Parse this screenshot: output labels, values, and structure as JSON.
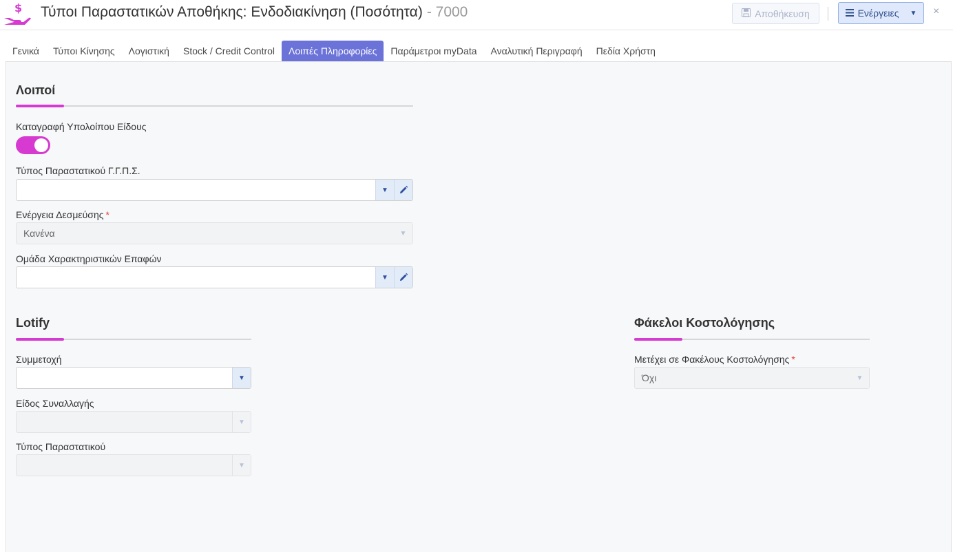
{
  "header": {
    "title": "Τύποι Παραστατικών Αποθήκης: Ενδοδιακίνηση (Ποσότητα)",
    "code": "- 7000",
    "save_label": "Αποθήκευση",
    "actions_label": "Ενέργειες",
    "close": "×"
  },
  "tabs": [
    {
      "label": "Γενικά"
    },
    {
      "label": "Τύποι Κίνησης"
    },
    {
      "label": "Λογιστική"
    },
    {
      "label": "Stock / Credit Control"
    },
    {
      "label": "Λοιπές Πληροφορίες",
      "active": true
    },
    {
      "label": "Παράμετροι myData"
    },
    {
      "label": "Αναλυτική Περιγραφή"
    },
    {
      "label": "Πεδία Χρήστη"
    }
  ],
  "sections": {
    "misc": {
      "title": "Λοιποί",
      "record_balance_label": "Καταγραφή Υπολοίπου Είδους",
      "record_balance_on": true,
      "ggps_label": "Τύπος Παραστατικού Γ.Γ.Π.Σ.",
      "ggps_value": "",
      "commit_label": "Ενέργεια Δεσμεύσης",
      "commit_value": "Κανένα",
      "contact_group_label": "Ομάδα Χαρακτηριστικών Επαφών",
      "contact_group_value": ""
    },
    "lotify": {
      "title": "Lotify",
      "participation_label": "Συμμετοχή",
      "participation_value": "",
      "transaction_type_label": "Είδος Συναλλαγής",
      "transaction_type_value": "",
      "document_type_label": "Τύπος Παραστατικού",
      "document_type_value": ""
    },
    "costing": {
      "title": "Φάκελοι Κοστολόγησης",
      "participates_label": "Μετέχει σε Φακέλους Κοστολόγησης",
      "participates_value": "Όχι"
    }
  },
  "required_mark": "*",
  "colors": {
    "accent": "#d63ad0",
    "active_tab": "#6b72d8",
    "actions_button": "#dfe9fb"
  }
}
